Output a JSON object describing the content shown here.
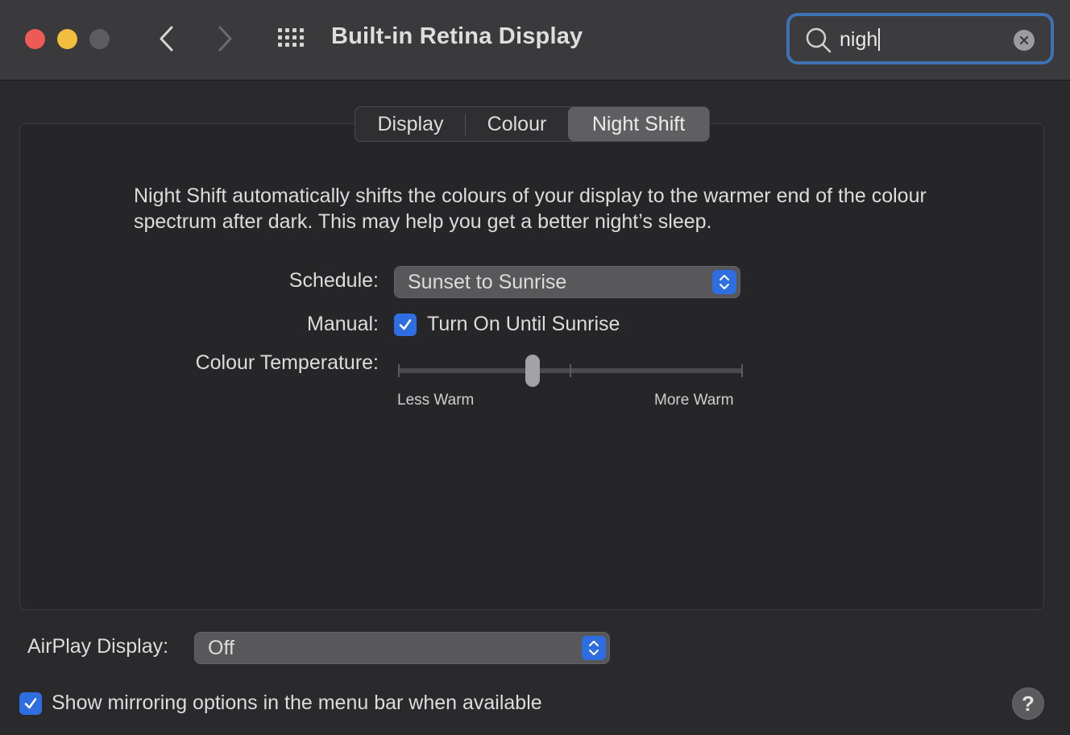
{
  "window": {
    "title": "Built-in Retina Display"
  },
  "search": {
    "value": "nigh",
    "icon": "search-icon",
    "clear_icon": "clear-icon"
  },
  "tabs": [
    {
      "label": "Display",
      "selected": false
    },
    {
      "label": "Colour",
      "selected": false
    },
    {
      "label": "Night Shift",
      "selected": true
    }
  ],
  "night_shift": {
    "description": "Night Shift automatically shifts the colours of your display to the warmer end of the colour spectrum after dark. This may help you get a better night’s sleep.",
    "schedule_label": "Schedule:",
    "schedule_value": "Sunset to Sunrise",
    "manual_label": "Manual:",
    "manual_checkbox_label": "Turn On Until Sunrise",
    "manual_checked": true,
    "temperature_label": "Colour Temperature:",
    "temperature_less": "Less Warm",
    "temperature_more": "More Warm",
    "temperature_level": 0.39
  },
  "airplay": {
    "label": "AirPlay Display:",
    "value": "Off"
  },
  "mirroring": {
    "label": "Show mirroring options in the menu bar when available",
    "checked": true
  },
  "help": {
    "label": "?"
  },
  "colors": {
    "accent": "#2e6ee0",
    "focus_ring": "#3f72b5",
    "close": "#ee5b54",
    "minimize": "#f3bd3e"
  }
}
